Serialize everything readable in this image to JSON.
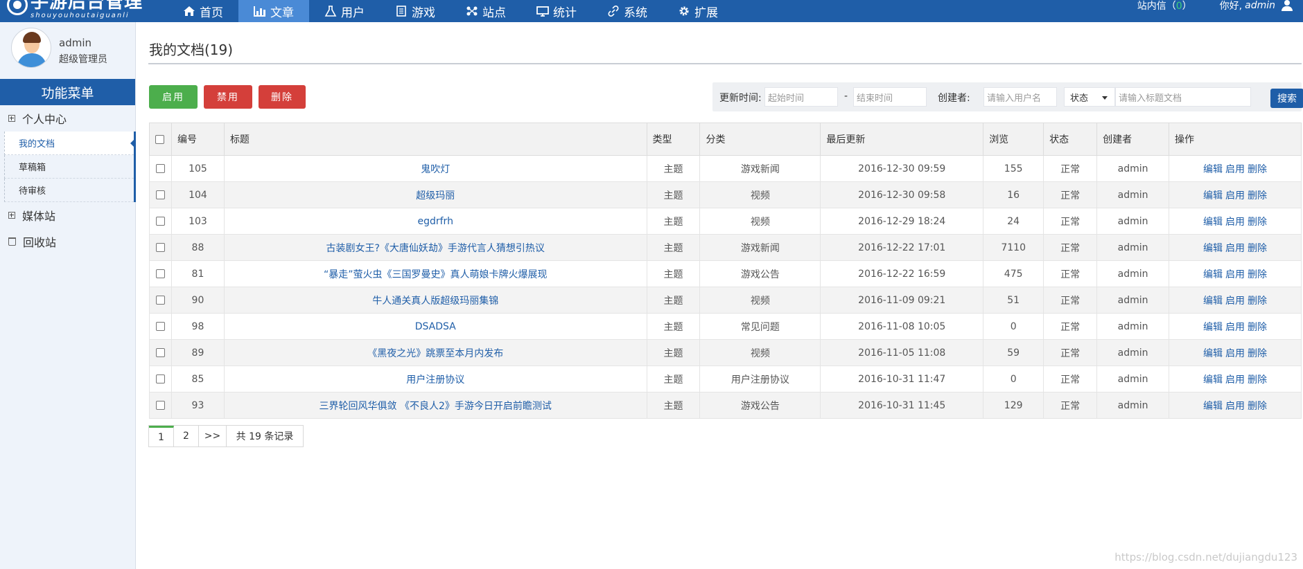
{
  "topbar": {
    "logo_cn": "手游后台管理",
    "logo_en": "shouyouhoutaiguanli",
    "nav": [
      {
        "label": "首页",
        "icon": "home-icon"
      },
      {
        "label": "文章",
        "icon": "bar-chart-icon"
      },
      {
        "label": "用户",
        "icon": "flask-icon"
      },
      {
        "label": "游戏",
        "icon": "document-icon"
      },
      {
        "label": "站点",
        "icon": "sitemap-icon"
      },
      {
        "label": "统计",
        "icon": "monitor-icon"
      },
      {
        "label": "系统",
        "icon": "link-icon"
      },
      {
        "label": "扩展",
        "icon": "gear-icon"
      }
    ],
    "messages_label": "站内信（",
    "messages_count": "0",
    "messages_close": "）",
    "greeting": "你好,",
    "username": "admin"
  },
  "sidebar": {
    "name": "admin",
    "role": "超级管理员",
    "menu_title": "功能菜单",
    "group_personal": "个人中心",
    "sub_items": [
      "我的文档",
      "草稿箱",
      "待审核"
    ],
    "group_media": "媒体站",
    "group_recycle": "回收站"
  },
  "main": {
    "title": "我的文档(19)",
    "btn_enable": "启用",
    "btn_disable": "禁用",
    "btn_delete": "删除",
    "filter": {
      "update_label": "更新时间:",
      "start_placeholder": "起始时间",
      "dash": "-",
      "end_placeholder": "结束时间",
      "creator_label": "创建者:",
      "user_placeholder": "请输入用户名",
      "status_select": "状态",
      "title_placeholder": "请输入标题文档",
      "search": "搜索"
    },
    "columns": [
      "编号",
      "标题",
      "类型",
      "分类",
      "最后更新",
      "浏览",
      "状态",
      "创建者",
      "操作"
    ],
    "op_edit": "编辑",
    "op_enable": "启用",
    "op_delete": "删除",
    "rows": [
      {
        "id": "105",
        "title": "鬼吹灯",
        "type": "主题",
        "category": "游戏新闻",
        "updated": "2016-12-30 09:59",
        "views": "155",
        "status": "正常",
        "creator": "admin"
      },
      {
        "id": "104",
        "title": "超级玛丽",
        "type": "主题",
        "category": "视频",
        "updated": "2016-12-30 09:58",
        "views": "16",
        "status": "正常",
        "creator": "admin"
      },
      {
        "id": "103",
        "title": "egdrfrh",
        "type": "主题",
        "category": "视频",
        "updated": "2016-12-29 18:24",
        "views": "24",
        "status": "正常",
        "creator": "admin"
      },
      {
        "id": "88",
        "title": "古装剧女王?《大唐仙妖劫》手游代言人猜想引热议",
        "type": "主题",
        "category": "游戏新闻",
        "updated": "2016-12-22 17:01",
        "views": "7110",
        "status": "正常",
        "creator": "admin"
      },
      {
        "id": "81",
        "title": "“暴走”萤火虫《三国罗曼史》真人萌娘卡牌火爆展现",
        "type": "主题",
        "category": "游戏公告",
        "updated": "2016-12-22 16:59",
        "views": "475",
        "status": "正常",
        "creator": "admin"
      },
      {
        "id": "90",
        "title": "牛人通关真人版超级玛丽集锦",
        "type": "主题",
        "category": "视频",
        "updated": "2016-11-09 09:21",
        "views": "51",
        "status": "正常",
        "creator": "admin"
      },
      {
        "id": "98",
        "title": "DSADSA",
        "type": "主题",
        "category": "常见问题",
        "updated": "2016-11-08 10:05",
        "views": "0",
        "status": "正常",
        "creator": "admin"
      },
      {
        "id": "89",
        "title": "《黑夜之光》跳票至本月内发布",
        "type": "主题",
        "category": "视频",
        "updated": "2016-11-05 11:08",
        "views": "59",
        "status": "正常",
        "creator": "admin"
      },
      {
        "id": "85",
        "title": "用户注册协议",
        "type": "主题",
        "category": "用户注册协议",
        "updated": "2016-10-31 11:47",
        "views": "0",
        "status": "正常",
        "creator": "admin"
      },
      {
        "id": "93",
        "title": "三界轮回风华俱敛 《不良人2》手游今日开启前瞻测试",
        "type": "主题",
        "category": "游戏公告",
        "updated": "2016-10-31 11:45",
        "views": "129",
        "status": "正常",
        "creator": "admin"
      }
    ],
    "pager": {
      "pages": [
        "1",
        "2"
      ],
      "next": ">>",
      "total": "共 19 条记录"
    }
  },
  "watermark": "https://blog.csdn.net/dujiangdu123"
}
